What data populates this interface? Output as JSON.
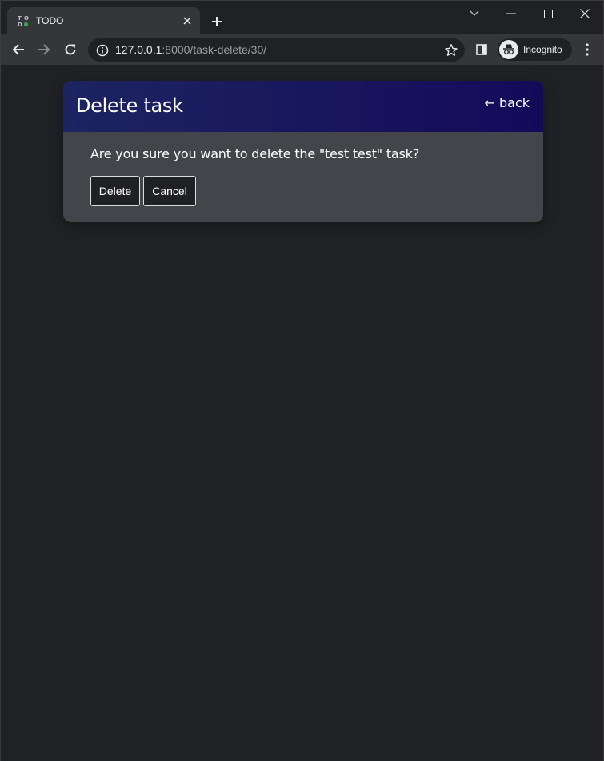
{
  "browser": {
    "tab": {
      "title": "TODO",
      "favicon": "todo-favicon"
    },
    "new_tab_symbol": "+",
    "url": {
      "host": "127.0.0.1",
      "rest": ":8000/task-delete/30/"
    },
    "profile_label": "Incognito"
  },
  "page": {
    "title": "Delete task",
    "back_link": "← back",
    "confirm_text": "Are you sure you want to delete the \"test test\" task?",
    "buttons": {
      "delete": "Delete",
      "cancel": "Cancel"
    }
  },
  "colors": {
    "page_bg": "#202124",
    "card_bg": "#43454a",
    "header_gradient_start": "#1d2461",
    "header_gradient_end": "#140a5a",
    "chrome_toolbar": "#35363a"
  }
}
